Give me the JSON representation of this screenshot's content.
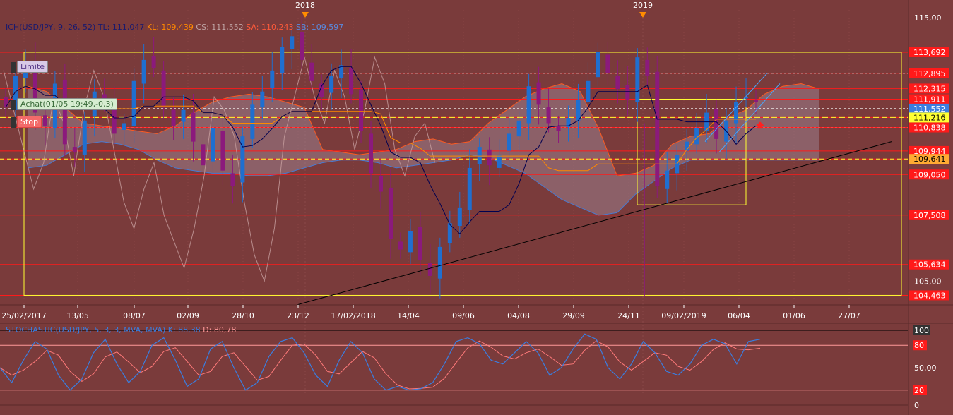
{
  "indicator_header": {
    "name": "ICH(USD/JPY, 9, 26, 52)",
    "tl": "TL: 111,047",
    "kl": "KL: 109,439",
    "cs": "CS: 111,552",
    "sa": "SA: 110,243",
    "sb": "SB: 109,597"
  },
  "stoch_header": {
    "name": "STOCHASTIC(USD/JPY, 5, 3, 3, MVA, MVA)",
    "k": "K: 88,38",
    "d": "D: 80,78"
  },
  "year_markers": [
    {
      "label": "2018"
    },
    {
      "label": "2019"
    }
  ],
  "orders": {
    "limit": "Limite",
    "achat": "Achat(01/05 19:49,-0,3)",
    "stop": "Stop"
  },
  "price_axis": {
    "ticks": [
      "115,00",
      "105,00"
    ],
    "level_labels": [
      {
        "text": "113,692",
        "value": 113.692
      },
      {
        "text": "112,895",
        "value": 112.895
      },
      {
        "text": "112,315",
        "value": 112.315
      },
      {
        "text": "111,911",
        "value": 111.911
      },
      {
        "text": "111,552",
        "value": 111.552
      },
      {
        "text": "111,216",
        "value": 111.216
      },
      {
        "text": "110,838",
        "value": 110.838
      },
      {
        "text": "109,944",
        "value": 109.944
      },
      {
        "text": "109,641",
        "value": 109.641
      },
      {
        "text": "109,050",
        "value": 109.05
      },
      {
        "text": "107,508",
        "value": 107.508
      },
      {
        "text": "105,634",
        "value": 105.634
      },
      {
        "text": "104,463",
        "value": 104.463
      }
    ]
  },
  "date_axis": [
    "25/02/2017",
    "13/05",
    "08/07",
    "02/09",
    "28/10",
    "23/12",
    "17/02/2018",
    "14/04",
    "09/06",
    "04/08",
    "29/09",
    "24/11",
    "09/02/2019",
    "06/04",
    "01/06",
    "27/07"
  ],
  "stoch_axis": [
    "100",
    "80",
    "50,00",
    "20",
    "0"
  ],
  "colors": {
    "background": "#7a3b3b",
    "bull": "#1f6fd0",
    "bear": "#8b1a7c",
    "level_red": "#ff1a1a",
    "yellow": "#ffff33",
    "kijun": "#ff8800",
    "tenkan": "#000050",
    "chikou": "#c8a0a0",
    "cloud": "#9a7f8e",
    "stoch_k": "#3a7ee0",
    "stoch_d": "#ff7a7a"
  },
  "chart_data": {
    "type": "candlestick",
    "price_range": [
      104.1,
      115.3
    ],
    "levels": [
      113.692,
      112.895,
      112.315,
      111.911,
      111.216,
      110.838,
      109.944,
      109.641,
      109.05,
      107.508,
      105.634,
      104.463
    ],
    "closes": [
      111.6,
      112.8,
      113.2,
      111.4,
      110.9,
      112.5,
      110.2,
      109.9,
      111.1,
      112.2,
      111.8,
      110.6,
      111.0,
      112.6,
      113.4,
      113.1,
      111.6,
      110.9,
      111.5,
      110.3,
      109.4,
      110.8,
      109.2,
      108.6,
      110.5,
      111.7,
      112.2,
      113.0,
      113.9,
      114.3,
      113.4,
      112.6,
      112.0,
      112.8,
      113.2,
      112.1,
      110.7,
      109.1,
      108.4,
      106.6,
      106.2,
      106.9,
      105.8,
      105.2,
      106.3,
      107.2,
      107.8,
      109.3,
      110.1,
      109.4,
      109.8,
      110.6,
      111.1,
      112.4,
      111.7,
      111.0,
      110.7,
      111.2,
      111.9,
      112.6,
      113.7,
      112.9,
      112.3,
      111.9,
      113.5,
      112.8,
      108.6,
      109.2,
      109.8,
      110.3,
      110.8,
      111.4,
      110.4,
      111.1,
      111.8,
      112.0,
      111.8
    ]
  },
  "stoch_data": {
    "k": [
      50,
      30,
      60,
      85,
      75,
      40,
      20,
      35,
      70,
      88,
      55,
      30,
      45,
      80,
      90,
      60,
      25,
      35,
      75,
      85,
      50,
      20,
      30,
      65,
      85,
      90,
      70,
      40,
      25,
      60,
      85,
      70,
      35,
      20,
      25,
      20,
      22,
      30,
      55,
      85,
      90,
      82,
      60,
      55,
      70,
      85,
      70,
      40,
      50,
      75,
      95,
      88,
      50,
      35,
      55,
      85,
      70,
      45,
      40,
      55,
      80,
      88,
      82,
      55,
      85,
      88
    ]
  }
}
